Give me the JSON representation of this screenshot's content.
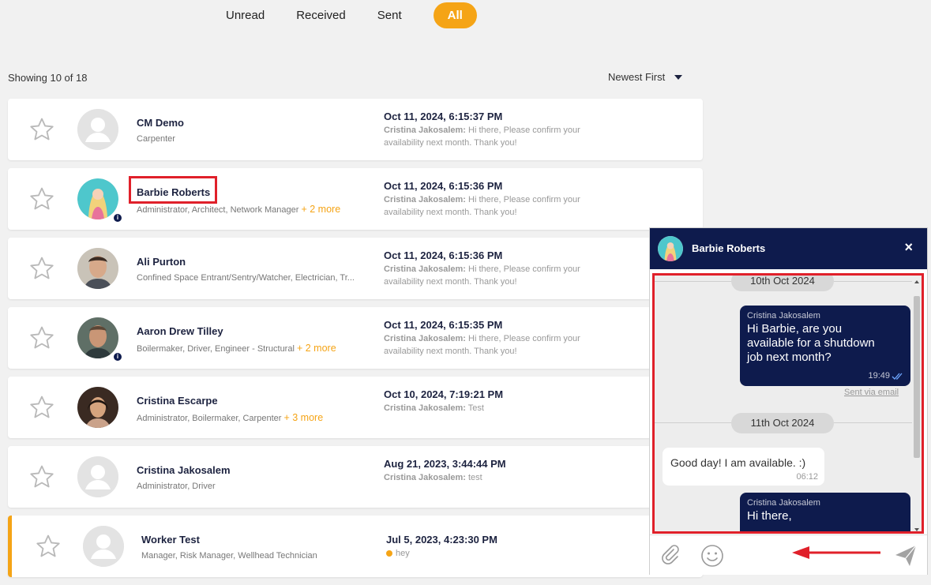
{
  "tabs": [
    {
      "label": "Unread"
    },
    {
      "label": "Received"
    },
    {
      "label": "Sent"
    },
    {
      "label": "All"
    }
  ],
  "list_summary": {
    "showing": "Showing 10 of 18",
    "sort": "Newest First"
  },
  "messages": [
    {
      "name": "CM Demo",
      "roles": "Carpenter",
      "more": "",
      "date": "Oct 11, 2024, 6:15:37 PM",
      "sender": "Cristina Jakosalem:",
      "preview": " Hi there, Please confirm your availability next month. Thank you!"
    },
    {
      "name": "Barbie Roberts",
      "roles": "Administrator, Architect, Network Manager",
      "more": "+ 2 more",
      "date": "Oct 11, 2024, 6:15:36 PM",
      "sender": "Cristina Jakosalem:",
      "preview": " Hi there, Please confirm your availability next month. Thank you!"
    },
    {
      "name": "Ali Purton",
      "roles": "Confined Space Entrant/Sentry/Watcher, Electrician, Tr...",
      "more": "",
      "date": "Oct 11, 2024, 6:15:36 PM",
      "sender": "Cristina Jakosalem:",
      "preview": " Hi there, Please confirm your availability next month. Thank you!"
    },
    {
      "name": "Aaron Drew Tilley",
      "roles": "Boilermaker, Driver, Engineer - Structural",
      "more": "+ 2 more",
      "date": "Oct 11, 2024, 6:15:35 PM",
      "sender": "Cristina Jakosalem:",
      "preview": " Hi there, Please confirm your availability next month. Thank you!"
    },
    {
      "name": "Cristina Escarpe",
      "roles": "Administrator, Boilermaker, Carpenter",
      "more": "+ 3 more",
      "date": "Oct 10, 2024, 7:19:21 PM",
      "sender": "Cristina Jakosalem:",
      "preview": " Test"
    },
    {
      "name": "Cristina Jakosalem",
      "roles": "Administrator, Driver",
      "more": "",
      "date": "Aug 21, 2023, 3:44:44 PM",
      "sender": "Cristina Jakosalem:",
      "preview": " test"
    },
    {
      "name": "Worker Test",
      "roles": "Manager, Risk Manager, Wellhead Technician",
      "more": "",
      "date": "Jul 5, 2023, 4:23:30 PM",
      "sender": "",
      "preview": "hey"
    }
  ],
  "chat": {
    "title": "Barbie Roberts",
    "close": "×",
    "date1": "10th Oct 2024",
    "msg1": {
      "sender": "Cristina Jakosalem",
      "line1": "Hi Barbie, are you",
      "line2": "available for a shutdown",
      "line3": "job next month?",
      "time": "19:49"
    },
    "sent_via": "Sent via email",
    "date2": "11th Oct 2024",
    "msg2": {
      "text": "Good day! I am available. :)",
      "time": "06:12"
    },
    "msg3": {
      "sender": "Cristina Jakosalem",
      "text": "Hi there,"
    }
  },
  "colors": {
    "accent": "#f5a416",
    "navy": "#0e1b4d",
    "highlight": "#e0202a"
  }
}
